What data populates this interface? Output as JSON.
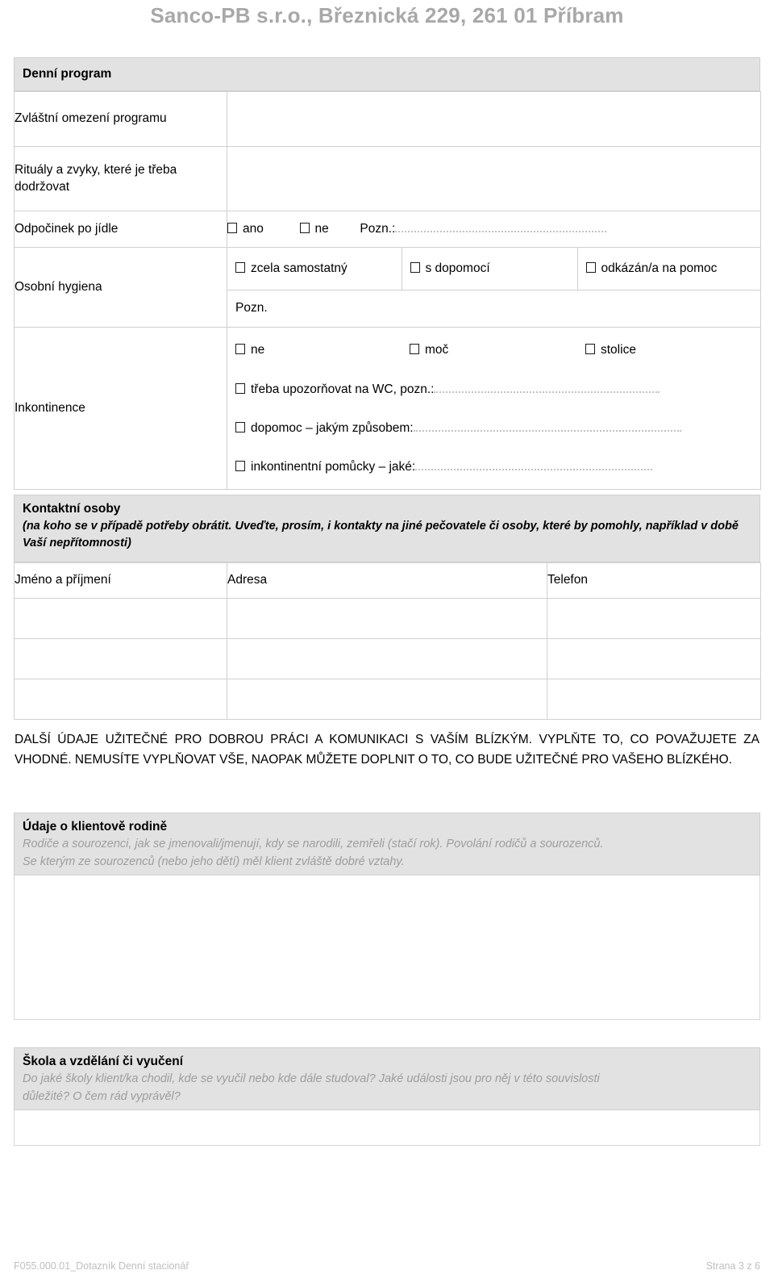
{
  "document": {
    "header_title": "Sanco-PB s.r.o., Březnická 229, 261 01 Příbram",
    "footer_left": "F055.000.01_Dotazník Denní stacionář",
    "footer_right": "Strana 3 z 6"
  },
  "daily_program": {
    "section_title": "Denní program",
    "rows": [
      {
        "label": "Zvláštní omezení programu"
      },
      {
        "label": "Rituály a zvyky, které je třeba dodržovat"
      },
      {
        "label": "Odpočinek po jídle"
      }
    ],
    "rest_after_meal": {
      "option_yes": "ano",
      "option_no": "ne",
      "note_label": "Pozn.:"
    },
    "hygiene": {
      "label": "Osobní hygiena",
      "options": [
        "zcela samostatný",
        "s dopomocí",
        "odkázán/a na pomoc"
      ],
      "note_label": "Pozn."
    },
    "incontinence": {
      "label": "Inkontinence",
      "top_options": [
        "ne",
        "moč",
        "stolice"
      ],
      "detail_options": [
        "třeba upozorňovat na WC, pozn.:",
        "dopomoc – jakým způsobem:",
        "inkontinentní pomůcky – jaké:"
      ]
    }
  },
  "contacts": {
    "section_title": "Kontaktní osoby",
    "section_note": "(na koho se v případě potřeby obrátit. Uveďte, prosím, i kontakty na jiné pečovatele či osoby, které by pomohly, například v době Vaší nepřítomnosti)",
    "columns": [
      "Jméno a příjmení",
      "Adresa",
      "Telefon"
    ],
    "rows": [
      {
        "name": "",
        "address": "",
        "phone": ""
      },
      {
        "name": "",
        "address": "",
        "phone": ""
      },
      {
        "name": "",
        "address": "",
        "phone": ""
      }
    ]
  },
  "instructions": {
    "text": "DALŠÍ ÚDAJE UŽITEČNÉ PRO DOBROU PRÁCI A KOMUNIKACI S VAŠÍM BLÍZKÝM. VYPLŇTE TO, CO POVAŽUJETE ZA VHODNÉ. NEMUSÍTE VYPLŇOVAT VŠE, NAOPAK MŮŽETE DOPLNIT O TO, CO BUDE UŽITEČNÉ PRO VAŠEHO BLÍZKÉHO."
  },
  "family_section": {
    "title": "Údaje o klientově rodině",
    "hint_line1": "Rodiče a sourozenci, jak se jmenovali/jmenují, kdy se narodili, zemřeli (stačí rok). Povolání rodičů a sourozenců.",
    "hint_line2": "Se kterým ze sourozenců (nebo jeho dětí) měl klient zvláště dobré vztahy.",
    "answer": ""
  },
  "school_section": {
    "title": "Škola a vzdělání či vyučení",
    "hint_line1": "Do jaké školy klient/ka chodil, kde se vyučil nebo kde dále studoval? Jaké události jsou pro něj v této souvislosti",
    "hint_line2": "důležité? O čem rád vyprávěl?",
    "answer": ""
  },
  "colors": {
    "header_gray": "#a8a8a8",
    "band_gray": "#e2e2e2",
    "border_gray": "#d0d0d0",
    "hint_gray": "#9d9d9d"
  }
}
